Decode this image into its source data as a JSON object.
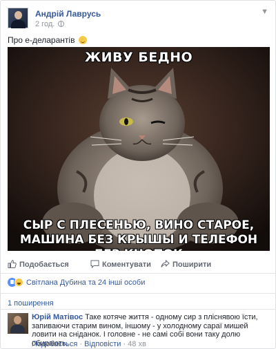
{
  "post": {
    "author": "Андрій Лаврусь",
    "time": "2 год.",
    "text": "Про е-деларантів",
    "image": {
      "caption_top": "ЖИВУ БЕДНО",
      "caption_bottom_1": "СЫР С ПЛЕСЕНЬЮ, ВИНО СТАРОЕ,",
      "caption_bottom_2": "МАШИНА БЕЗ КРЫШЫ И ТЕЛЕФОН БЕЗ КНОПОК"
    }
  },
  "actions": {
    "like": "Подобається",
    "comment": "Коментувати",
    "share": "Поширити"
  },
  "reactions": {
    "text": "Світлана Дубина та 24 інші особи"
  },
  "shares": {
    "text": "1 поширення"
  },
  "comment": {
    "author": "Юрій Матівос",
    "text": "Таке котяче життя - одному сир з пліснявою їсти, запиваючи старим вином, іншому - у холодному сараї мишей ловити на сніданок. І головне - не самі собі вони таку долю обирають.",
    "like": "Подобається",
    "reply": "Відповісти",
    "time": "48 хв"
  },
  "colors": {
    "link": "#365899",
    "muted": "#90949c",
    "accent_like": "#5890ff"
  }
}
